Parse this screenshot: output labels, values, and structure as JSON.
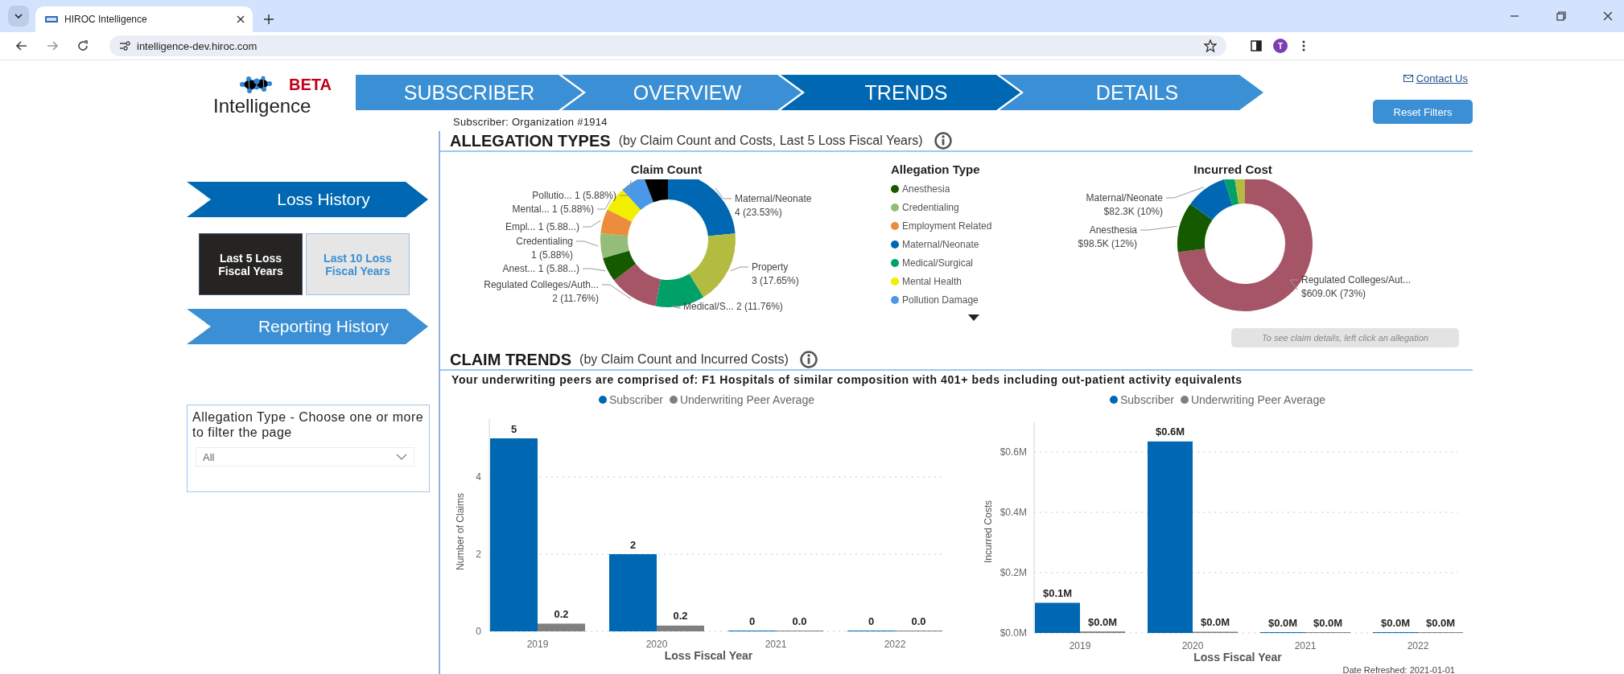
{
  "browser": {
    "tab_title": "HIROC Intelligence",
    "url": "intelligence-dev.hiroc.com",
    "profile_initial": "T"
  },
  "header": {
    "logo_badge": "BETA",
    "logo_text": "Intelligence",
    "nav": [
      {
        "label": "SUBSCRIBER",
        "selected": false
      },
      {
        "label": "OVERVIEW",
        "selected": false
      },
      {
        "label": "TRENDS",
        "selected": true
      },
      {
        "label": "DETAILS",
        "selected": false
      }
    ],
    "subscriber": "Subscriber: Organization #1914",
    "contact_link": "Contact Us",
    "reset_button": "Reset Filters"
  },
  "sidebar": {
    "sections": [
      {
        "label": "Loss History",
        "selected": true
      },
      {
        "label": "Reporting History",
        "selected": false
      }
    ],
    "periods": [
      {
        "label": "Last 5 Loss Fiscal Years",
        "selected": true
      },
      {
        "label": "Last 10 Loss Fiscal Years",
        "selected": false
      }
    ],
    "filter": {
      "title": "Allegation Type - Choose one or more to filter the page",
      "value": "All"
    }
  },
  "allegation_types": {
    "title": "ALLEGATION TYPES",
    "subtitle": "(by Claim Count and Costs, Last 5 Loss Fiscal Years)",
    "claim_count": {
      "chart_data": {
        "type": "donut",
        "title": "Claim Count",
        "categories": [
          "Maternal/Neonate",
          "Property",
          "Medical/S...",
          "Regulated Colleges/Auth...",
          "Anest...",
          "Credentialing",
          "Empl...",
          "Mental...",
          "Pollutio...",
          null
        ],
        "series": [
          {
            "values": [
              23.53,
              17.65,
              11.76,
              11.76,
              5.88,
              5.88,
              5.88,
              5.88,
              5.88,
              5.88
            ]
          }
        ],
        "colors": [
          "#0068b3",
          "#b3bb40",
          "#00a167",
          "#a55566",
          "#165a00",
          "#94bd7a",
          "#eb8d3d",
          "#f2ef00",
          "#4b97e8",
          "#000000"
        ],
        "value_labels": [
          "4 (23.53%)",
          "3 (17.65%)",
          "2 (11.76%)",
          "2 (11.76%)",
          "1 (5.88...)",
          "1 (5.88%)",
          "1 (5.88...)",
          "1 (5.88%)",
          "1 (5.88%)",
          null
        ]
      }
    },
    "legend": {
      "title": "Allegation Type",
      "scroll_down": true,
      "items": [
        {
          "label": "Anesthesia",
          "color": "#165a00"
        },
        {
          "label": "Credentialing",
          "color": "#94bd7a"
        },
        {
          "label": "Employment Related",
          "color": "#eb8d3d"
        },
        {
          "label": "Maternal/Neonate",
          "color": "#0068b3"
        },
        {
          "label": "Medical/Surgical",
          "color": "#00a167"
        },
        {
          "label": "Mental Health",
          "color": "#f2ef00"
        },
        {
          "label": "Pollution Damage",
          "color": "#4b97e8"
        }
      ]
    },
    "incurred_cost": {
      "chart_data": {
        "type": "donut",
        "title": "Incurred Cost",
        "categories": [
          "Regulated Colleges/Aut...",
          "Anesthesia",
          "Maternal/Neonate",
          null,
          null
        ],
        "series": [
          {
            "values": [
              73,
              12,
              10,
              2.5,
              2.5
            ]
          }
        ],
        "colors": [
          "#a55566",
          "#165a00",
          "#0068b3",
          "#00a167",
          "#b3bb40"
        ],
        "value_labels": [
          "$609.0K (73%)",
          "$98.5K (12%)",
          "$82.3K (10%)",
          null,
          null
        ]
      }
    },
    "hint": "To see claim details, left click an allegation"
  },
  "claim_trends": {
    "title": "CLAIM TRENDS",
    "subtitle": "(by Claim Count and Incurred Costs)",
    "peers_note": "Your underwriting peers are comprised of: F1 Hospitals of similar composition with 401+ beds including out-patient activity equivalents",
    "count_chart": {
      "chart_data": {
        "type": "bar",
        "xlabel": "Loss Fiscal Year",
        "ylabel": "Number of Claims",
        "categories": [
          "2019",
          "2020",
          "2021",
          "2022"
        ],
        "series": [
          {
            "name": "Subscriber",
            "color": "#0068b3",
            "values": [
              5,
              2,
              0,
              0
            ],
            "value_labels": [
              "5",
              "2",
              "0",
              "0"
            ]
          },
          {
            "name": "Underwriting Peer Average",
            "color": "#7f7f7f",
            "values": [
              0.2,
              0.15,
              0,
              0
            ],
            "value_labels": [
              "0.2",
              "0.2",
              "0.0",
              "0.0"
            ]
          }
        ],
        "grid": true,
        "ylim": [
          0,
          5.5
        ],
        "yticks": [
          0,
          2,
          4
        ]
      }
    },
    "cost_chart": {
      "chart_data": {
        "type": "bar",
        "xlabel": "Loss Fiscal Year",
        "ylabel": "Incurred Costs",
        "categories": [
          "2019",
          "2020",
          "2021",
          "2022"
        ],
        "series": [
          {
            "name": "Subscriber",
            "color": "#0068b3",
            "values": [
              0.1,
              0.635,
              0,
              0
            ],
            "value_labels": [
              "$0.1M",
              "$0.6M",
              "$0.0M",
              "$0.0M"
            ]
          },
          {
            "name": "Underwriting Peer Average",
            "color": "#7f7f7f",
            "values": [
              0.005,
              0.004,
              0,
              0
            ],
            "value_labels": [
              "$0.0M",
              "$0.0M",
              "$0.0M",
              "$0.0M"
            ]
          }
        ],
        "grid": true,
        "ylim": [
          0,
          0.7
        ],
        "yticks": [
          {
            "value": 0,
            "label": "$0.0M"
          },
          {
            "value": 0.2,
            "label": "$0.2M"
          },
          {
            "value": 0.4,
            "label": "$0.4M"
          },
          {
            "value": 0.6,
            "label": "$0.6M"
          }
        ]
      }
    },
    "date_refreshed": "Date Refreshed: 2021-01-01"
  }
}
